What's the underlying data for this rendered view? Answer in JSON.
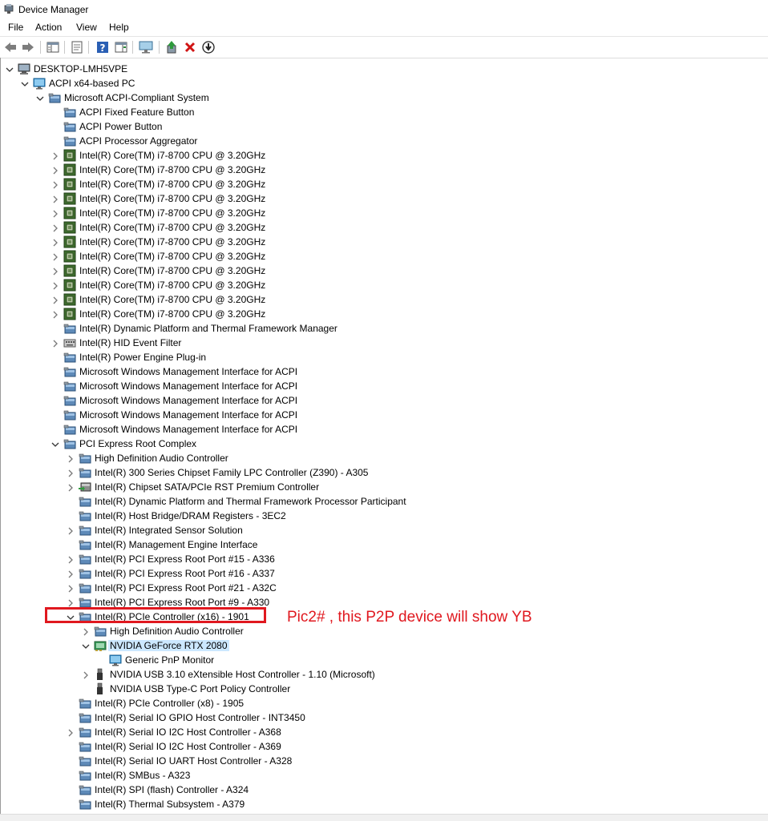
{
  "window": {
    "title": "Device Manager"
  },
  "menu": [
    "File",
    "Action",
    "View",
    "Help"
  ],
  "toolbar": [
    "back-arrow-icon",
    "forward-arrow-icon",
    "show-hide-console-tree-icon",
    "properties-icon",
    "help-icon",
    "action-pane-icon",
    "display-monitor-icon",
    "update-driver-icon",
    "uninstall-device-icon",
    "disable-device-icon"
  ],
  "tree": [
    {
      "label": "DESKTOP-LMH5VPE",
      "depth": 0,
      "expander": "open",
      "icon": "computer"
    },
    {
      "label": "ACPI x64-based PC",
      "depth": 1,
      "expander": "open",
      "icon": "monitor"
    },
    {
      "label": "Microsoft ACPI-Compliant System",
      "depth": 2,
      "expander": "open",
      "icon": "device"
    },
    {
      "label": "ACPI Fixed Feature Button",
      "depth": 3,
      "expander": "none",
      "icon": "device"
    },
    {
      "label": "ACPI Power Button",
      "depth": 3,
      "expander": "none",
      "icon": "device"
    },
    {
      "label": "ACPI Processor Aggregator",
      "depth": 3,
      "expander": "none",
      "icon": "device"
    },
    {
      "label": "Intel(R) Core(TM) i7-8700 CPU @ 3.20GHz",
      "depth": 3,
      "expander": "closed",
      "icon": "cpu"
    },
    {
      "label": "Intel(R) Core(TM) i7-8700 CPU @ 3.20GHz",
      "depth": 3,
      "expander": "closed",
      "icon": "cpu"
    },
    {
      "label": "Intel(R) Core(TM) i7-8700 CPU @ 3.20GHz",
      "depth": 3,
      "expander": "closed",
      "icon": "cpu"
    },
    {
      "label": "Intel(R) Core(TM) i7-8700 CPU @ 3.20GHz",
      "depth": 3,
      "expander": "closed",
      "icon": "cpu"
    },
    {
      "label": "Intel(R) Core(TM) i7-8700 CPU @ 3.20GHz",
      "depth": 3,
      "expander": "closed",
      "icon": "cpu"
    },
    {
      "label": "Intel(R) Core(TM) i7-8700 CPU @ 3.20GHz",
      "depth": 3,
      "expander": "closed",
      "icon": "cpu"
    },
    {
      "label": "Intel(R) Core(TM) i7-8700 CPU @ 3.20GHz",
      "depth": 3,
      "expander": "closed",
      "icon": "cpu"
    },
    {
      "label": "Intel(R) Core(TM) i7-8700 CPU @ 3.20GHz",
      "depth": 3,
      "expander": "closed",
      "icon": "cpu"
    },
    {
      "label": "Intel(R) Core(TM) i7-8700 CPU @ 3.20GHz",
      "depth": 3,
      "expander": "closed",
      "icon": "cpu"
    },
    {
      "label": "Intel(R) Core(TM) i7-8700 CPU @ 3.20GHz",
      "depth": 3,
      "expander": "closed",
      "icon": "cpu"
    },
    {
      "label": "Intel(R) Core(TM) i7-8700 CPU @ 3.20GHz",
      "depth": 3,
      "expander": "closed",
      "icon": "cpu"
    },
    {
      "label": "Intel(R) Core(TM) i7-8700 CPU @ 3.20GHz",
      "depth": 3,
      "expander": "closed",
      "icon": "cpu"
    },
    {
      "label": "Intel(R) Dynamic Platform and Thermal Framework Manager",
      "depth": 3,
      "expander": "none",
      "icon": "device"
    },
    {
      "label": "Intel(R) HID Event Filter",
      "depth": 3,
      "expander": "closed",
      "icon": "keyboard"
    },
    {
      "label": "Intel(R) Power Engine Plug-in",
      "depth": 3,
      "expander": "none",
      "icon": "device"
    },
    {
      "label": "Microsoft Windows Management Interface for ACPI",
      "depth": 3,
      "expander": "none",
      "icon": "device"
    },
    {
      "label": "Microsoft Windows Management Interface for ACPI",
      "depth": 3,
      "expander": "none",
      "icon": "device"
    },
    {
      "label": "Microsoft Windows Management Interface for ACPI",
      "depth": 3,
      "expander": "none",
      "icon": "device"
    },
    {
      "label": "Microsoft Windows Management Interface for ACPI",
      "depth": 3,
      "expander": "none",
      "icon": "device"
    },
    {
      "label": "Microsoft Windows Management Interface for ACPI",
      "depth": 3,
      "expander": "none",
      "icon": "device"
    },
    {
      "label": "PCI Express Root Complex",
      "depth": 3,
      "expander": "open",
      "icon": "device"
    },
    {
      "label": "High Definition Audio Controller",
      "depth": 4,
      "expander": "closed",
      "icon": "device"
    },
    {
      "label": "Intel(R) 300 Series Chipset Family LPC Controller (Z390) - A305",
      "depth": 4,
      "expander": "closed",
      "icon": "device"
    },
    {
      "label": "Intel(R) Chipset SATA/PCIe RST Premium Controller",
      "depth": 4,
      "expander": "closed",
      "icon": "storage"
    },
    {
      "label": "Intel(R) Dynamic Platform and Thermal Framework Processor Participant",
      "depth": 4,
      "expander": "none",
      "icon": "device"
    },
    {
      "label": "Intel(R) Host Bridge/DRAM Registers - 3EC2",
      "depth": 4,
      "expander": "none",
      "icon": "device"
    },
    {
      "label": "Intel(R) Integrated Sensor Solution",
      "depth": 4,
      "expander": "closed",
      "icon": "device"
    },
    {
      "label": "Intel(R) Management Engine Interface",
      "depth": 4,
      "expander": "none",
      "icon": "device"
    },
    {
      "label": "Intel(R) PCI Express Root Port #15 - A336",
      "depth": 4,
      "expander": "closed",
      "icon": "device"
    },
    {
      "label": "Intel(R) PCI Express Root Port #16 - A337",
      "depth": 4,
      "expander": "closed",
      "icon": "device"
    },
    {
      "label": "Intel(R) PCI Express Root Port #21 - A32C",
      "depth": 4,
      "expander": "closed",
      "icon": "device"
    },
    {
      "label": "Intel(R) PCI Express Root Port #9 - A330",
      "depth": 4,
      "expander": "closed",
      "icon": "device"
    },
    {
      "label": "Intel(R) PCIe Controller (x16) - 1901",
      "depth": 4,
      "expander": "open",
      "icon": "device"
    },
    {
      "label": "High Definition Audio Controller",
      "depth": 5,
      "expander": "closed",
      "icon": "device"
    },
    {
      "label": "NVIDIA GeForce RTX 2080",
      "depth": 5,
      "expander": "open",
      "icon": "display",
      "selected": true
    },
    {
      "label": "Generic PnP Monitor",
      "depth": 6,
      "expander": "none",
      "icon": "monitor"
    },
    {
      "label": "NVIDIA USB 3.10 eXtensible Host Controller - 1.10 (Microsoft)",
      "depth": 5,
      "expander": "closed",
      "icon": "usb"
    },
    {
      "label": "NVIDIA USB Type-C Port Policy Controller",
      "depth": 5,
      "expander": "none",
      "icon": "usb"
    },
    {
      "label": "Intel(R) PCIe Controller (x8) - 1905",
      "depth": 4,
      "expander": "none",
      "icon": "device"
    },
    {
      "label": "Intel(R) Serial IO GPIO Host Controller - INT3450",
      "depth": 4,
      "expander": "none",
      "icon": "device"
    },
    {
      "label": "Intel(R) Serial IO I2C Host Controller - A368",
      "depth": 4,
      "expander": "closed",
      "icon": "device"
    },
    {
      "label": "Intel(R) Serial IO I2C Host Controller - A369",
      "depth": 4,
      "expander": "none",
      "icon": "device"
    },
    {
      "label": "Intel(R) Serial IO UART Host Controller - A328",
      "depth": 4,
      "expander": "none",
      "icon": "device"
    },
    {
      "label": "Intel(R) SMBus - A323",
      "depth": 4,
      "expander": "none",
      "icon": "device"
    },
    {
      "label": "Intel(R) SPI (flash) Controller - A324",
      "depth": 4,
      "expander": "none",
      "icon": "device"
    },
    {
      "label": "Intel(R) Thermal Subsystem - A379",
      "depth": 4,
      "expander": "none",
      "icon": "device"
    }
  ],
  "annotation": {
    "text": "Pic2# , this P2P device will show YB",
    "color": "#e0181f"
  },
  "colors": {
    "selection": "#cce8ff",
    "annotation": "#e0181f"
  }
}
